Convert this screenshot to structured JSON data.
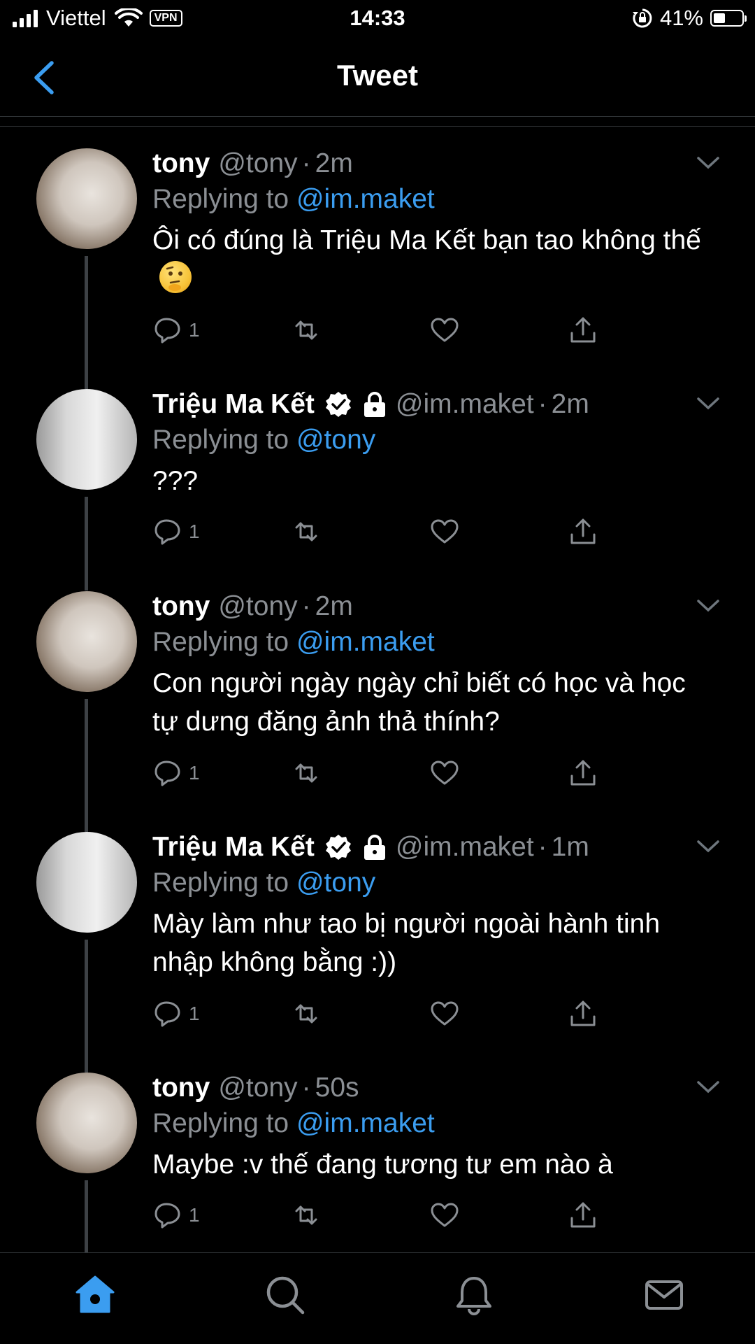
{
  "status_bar": {
    "carrier": "Viettel",
    "vpn": "VPN",
    "time": "14:33",
    "battery": "41%",
    "battery_level": 0.41
  },
  "header": {
    "title": "Tweet",
    "back_icon": "chevron-left-icon"
  },
  "colors": {
    "accent": "#3b9df0",
    "muted": "#8b8f94",
    "background": "#000000"
  },
  "tweets": [
    {
      "name": "tony",
      "handle": "@tony",
      "sep": "·",
      "time": "2m",
      "replying_prefix": "Replying to ",
      "replying_to": "@im.maket",
      "text": "Ôi có đúng là Triệu Ma Kết bạn tao không thế",
      "emoji": "thinking-face",
      "reply_count": "1"
    },
    {
      "name": "Triệu Ma Kết",
      "handle": "@im.maket",
      "sep": "·",
      "time": "2m",
      "replying_prefix": "Replying to ",
      "replying_to": "@tony",
      "text": "???",
      "verified": true,
      "protected": true,
      "reply_count": "1"
    },
    {
      "name": "tony",
      "handle": "@tony",
      "sep": "·",
      "time": "2m",
      "replying_prefix": "Replying to ",
      "replying_to": "@im.maket",
      "text": "Con người ngày ngày chỉ biết có học và học tự dưng đăng ảnh thả thính?",
      "reply_count": "1"
    },
    {
      "name": "Triệu Ma Kết",
      "handle": "@im.maket",
      "sep": "·",
      "time": "1m",
      "replying_prefix": "Replying to ",
      "replying_to": "@tony",
      "text": "Mày làm như tao bị người ngoài hành tinh nhập không bằng :))",
      "verified": true,
      "protected": true,
      "reply_count": "1"
    },
    {
      "name": "tony",
      "handle": "@tony",
      "sep": "·",
      "time": "50s",
      "replying_prefix": "Replying to ",
      "replying_to": "@im.maket",
      "text": "Maybe :v thế đang tương tư em nào à",
      "reply_count": "1"
    }
  ],
  "tab_bar": {
    "active": "home",
    "tabs": [
      "home-icon",
      "search-icon",
      "bell-icon",
      "mail-icon"
    ]
  }
}
